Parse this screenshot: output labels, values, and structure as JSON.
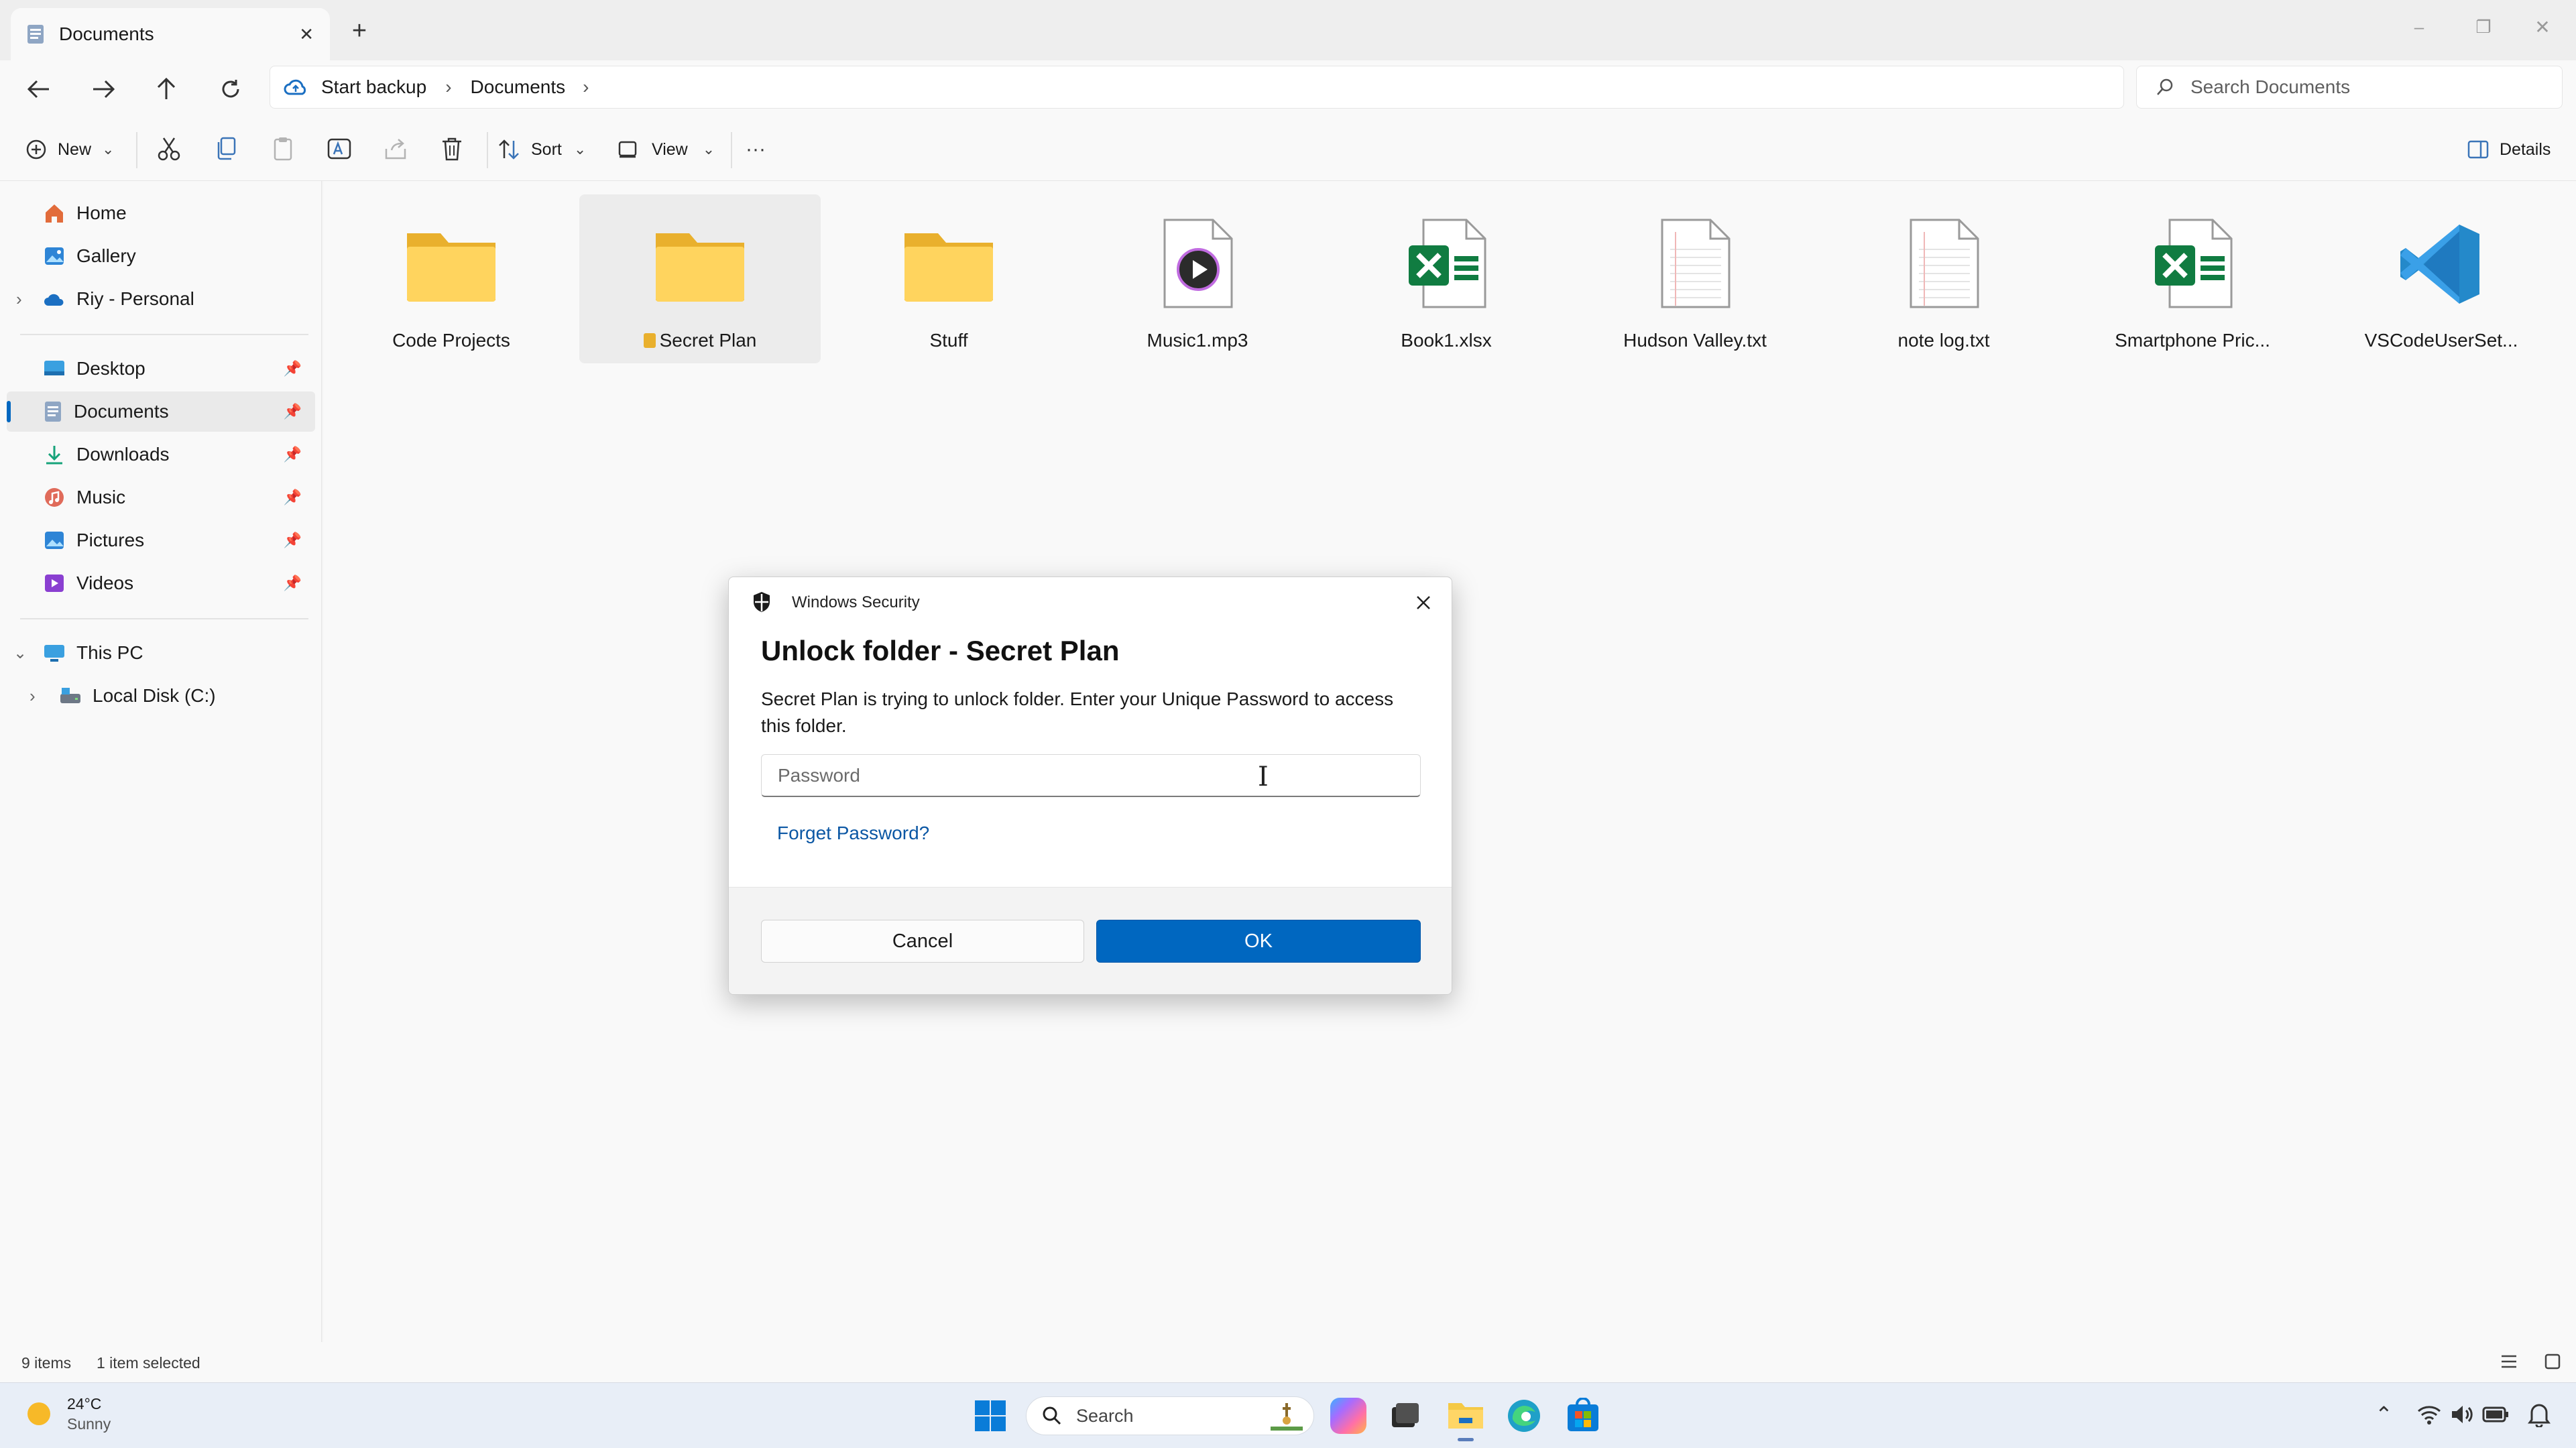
{
  "window": {
    "tab_title": "Documents",
    "new_tab": "+",
    "controls": {
      "minimize": "–",
      "maximize": "❐",
      "close": "✕"
    }
  },
  "address": {
    "backup_label": "Start backup",
    "crumb": "Documents",
    "search_placeholder": "Search Documents"
  },
  "toolbar": {
    "new_label": "New",
    "sort_label": "Sort",
    "view_label": "View",
    "more_label": "···",
    "details_label": "Details"
  },
  "sidebar": {
    "home": "Home",
    "gallery": "Gallery",
    "onedrive": "Riy - Personal",
    "desktop": "Desktop",
    "documents": "Documents",
    "downloads": "Downloads",
    "music": "Music",
    "pictures": "Pictures",
    "videos": "Videos",
    "thispc": "This PC",
    "localdisk": "Local Disk (C:)"
  },
  "files": [
    {
      "name": "Code Projects",
      "type": "folder"
    },
    {
      "name": "Secret Plan",
      "type": "folder-locked",
      "selected": true
    },
    {
      "name": "Stuff",
      "type": "folder"
    },
    {
      "name": "Music1.mp3",
      "type": "audio"
    },
    {
      "name": "Book1.xlsx",
      "type": "excel"
    },
    {
      "name": "Hudson Valley.txt",
      "type": "text"
    },
    {
      "name": "note log.txt",
      "type": "text"
    },
    {
      "name": "Smartphone Pric...",
      "type": "excel"
    },
    {
      "name": "VSCodeUserSet...",
      "type": "vscode"
    }
  ],
  "status": {
    "count": "9 items",
    "selected": "1 item selected"
  },
  "dialog": {
    "caption": "Windows Security",
    "title": "Unlock folder - Secret Plan",
    "message": "Secret Plan is trying to unlock folder. Enter your Unique Password to access this folder.",
    "password_placeholder": "Password",
    "forgot_link": "Forget Password?",
    "cancel_label": "Cancel",
    "ok_label": "OK"
  },
  "taskbar": {
    "temperature": "24°C",
    "condition": "Sunny",
    "search_label": "Search"
  },
  "colors": {
    "accent": "#0067c0",
    "folder": "#f5c945",
    "excel": "#107c41",
    "vscode": "#2489ca"
  }
}
